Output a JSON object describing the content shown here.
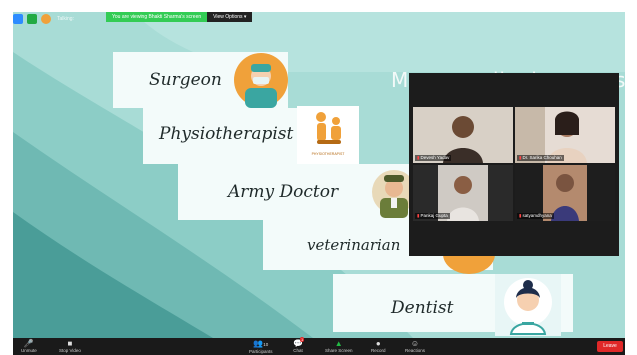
{
  "banner": {
    "sharing_text": "You are viewing Bhakti Sharma's screen",
    "view_options_label": "View Options ▾"
  },
  "top_bar": {
    "talking_label": "Talking:"
  },
  "slide": {
    "heading_faint": "More medical careers",
    "rows": [
      {
        "label": "Surgeon",
        "icon": "surgeon-icon"
      },
      {
        "label": "Physiotherapist",
        "icon": "physiotherapist-icon"
      },
      {
        "label": "Army Doctor",
        "icon": "army-doctor-icon"
      },
      {
        "label": "veterinarian",
        "icon": "veterinarian-icon"
      },
      {
        "label": "Dentist",
        "icon": "dentist-icon"
      }
    ],
    "physio_caption": "PHYSIOTHERAPIST"
  },
  "participants": [
    {
      "name": "Devesh Yadav",
      "muted": true,
      "video_color": "#5a4a3a"
    },
    {
      "name": "Dr. Sarika Chouhan",
      "muted": true,
      "video_color": "#b08a78"
    },
    {
      "name": "Pankaj Gupta",
      "muted": true,
      "video_color": "#3d3a3a"
    },
    {
      "name": "satyamdhyana",
      "muted": true,
      "video_color": "#7a5a4a"
    }
  ],
  "toolbar": {
    "unmute_label": "Unmute",
    "stop_video_label": "Stop Video",
    "participants_label": "Participants",
    "participants_count": "10",
    "chat_label": "Chat",
    "chat_badge": "1",
    "share_screen_label": "Share Screen",
    "record_label": "Record",
    "reactions_label": "Reactions",
    "leave_label": "Leave"
  },
  "colors": {
    "teal_light": "#a8dcd6",
    "teal_mid": "#6fb9b3",
    "teal_dark": "#4a9d98",
    "accent_orange": "#f0a13a",
    "toolbar_bg": "#1a1a1a",
    "leave_red": "#e02828",
    "share_green": "#33cc55",
    "video_green": "#22bb44"
  }
}
